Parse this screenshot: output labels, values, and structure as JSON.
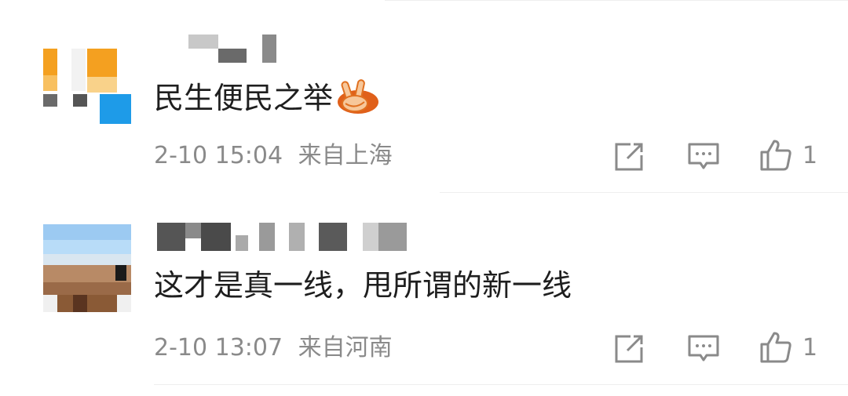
{
  "comments": [
    {
      "text": "民生便民之举",
      "emoji": "victory-hand-emoji",
      "time": "2-10 15:04",
      "location": "来自上海",
      "likes": "1"
    },
    {
      "text": "这才是真一线，甩所谓的新一线",
      "time": "2-10 13:07",
      "location": "来自河南",
      "likes": "1"
    }
  ],
  "actions": {
    "share_icon": "share-icon",
    "reply_icon": "reply-icon",
    "like_icon": "thumbs-up-icon"
  },
  "colors": {
    "meta_text": "#8a8a8a",
    "comment_text": "#1e1e1e",
    "icon": "#8a8a8a"
  }
}
